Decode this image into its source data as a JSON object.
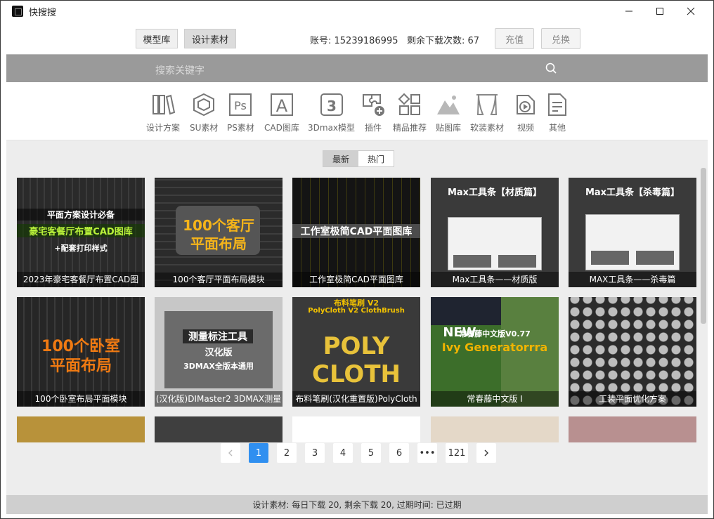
{
  "window": {
    "title": "快搜搜"
  },
  "top": {
    "tabs": [
      {
        "label": "模型库"
      },
      {
        "label": "设计素材"
      }
    ],
    "account_label": "账号: 15239186995",
    "remaining_label": "剩余下载次数: 67",
    "recharge": "充值",
    "exchange": "兑换"
  },
  "search": {
    "placeholder": "搜索关键字"
  },
  "categories": [
    {
      "label": "设计方案",
      "icon": "books-icon"
    },
    {
      "label": "SU素材",
      "icon": "sketchup-icon"
    },
    {
      "label": "PS素材",
      "icon": "ps-icon"
    },
    {
      "label": "CAD图库",
      "icon": "cad-icon"
    },
    {
      "label": "3Dmax模型",
      "icon": "3dmax-icon"
    },
    {
      "label": "插件",
      "icon": "plugin-icon"
    },
    {
      "label": "精品推荐",
      "icon": "grid-icon"
    },
    {
      "label": "贴图库",
      "icon": "mountain-icon"
    },
    {
      "label": "软装素材",
      "icon": "curtain-icon"
    },
    {
      "label": "视频",
      "icon": "video-icon"
    },
    {
      "label": "其他",
      "icon": "other-icon"
    }
  ],
  "sort_tabs": [
    {
      "label": "最新"
    },
    {
      "label": "热门"
    }
  ],
  "cards": [
    {
      "caption": "2023年豪宅客餐厅布置CAD图",
      "art": [
        "平面方案设计必备",
        "豪宅客餐厅布置CAD图库",
        "+配套打印样式"
      ]
    },
    {
      "caption": "100个客厅平面布局模块",
      "art": [
        "100个客厅",
        "平面布局"
      ]
    },
    {
      "caption": "工作室极简CAD平面图库",
      "art": [
        "工作室极简CAD平面图库"
      ]
    },
    {
      "caption": "Max工具条——材质版",
      "art": [
        "Max工具条【材质篇】"
      ]
    },
    {
      "caption": "MAX工具条——杀毒篇",
      "art": [
        "Max工具条【杀毒篇】"
      ]
    },
    {
      "caption": "100个卧室布局平面模块",
      "art": [
        "100个卧室",
        "平面布局"
      ]
    },
    {
      "caption": "(汉化版)DIMaster2 3DMAX测量",
      "art": [
        "测量标注工具",
        "汉化版",
        "3DMAX全版本通用"
      ]
    },
    {
      "caption": "布料笔刷(汉化重置版)PolyCloth",
      "art": [
        "布料笔刷 V2",
        "PolyCloth V2 ClothBrush",
        "POLY",
        "CLOTH"
      ]
    },
    {
      "caption": "常春藤中文版 I",
      "art": [
        "常春藤中文版V0.77",
        "NEW",
        "Ivy Generatorrra"
      ]
    },
    {
      "caption": "工装平面优化方案",
      "art": []
    }
  ],
  "pagination": {
    "pages": [
      "1",
      "2",
      "3",
      "4",
      "5",
      "6",
      "•••",
      "121"
    ],
    "current": "1"
  },
  "status": "设计素材: 每日下载 20, 剩余下载 20, 过期时间: 已过期",
  "colors": {
    "accent": "#2f8ff0",
    "search_bg": "#9a9a9a",
    "content_bg": "#ededed"
  }
}
